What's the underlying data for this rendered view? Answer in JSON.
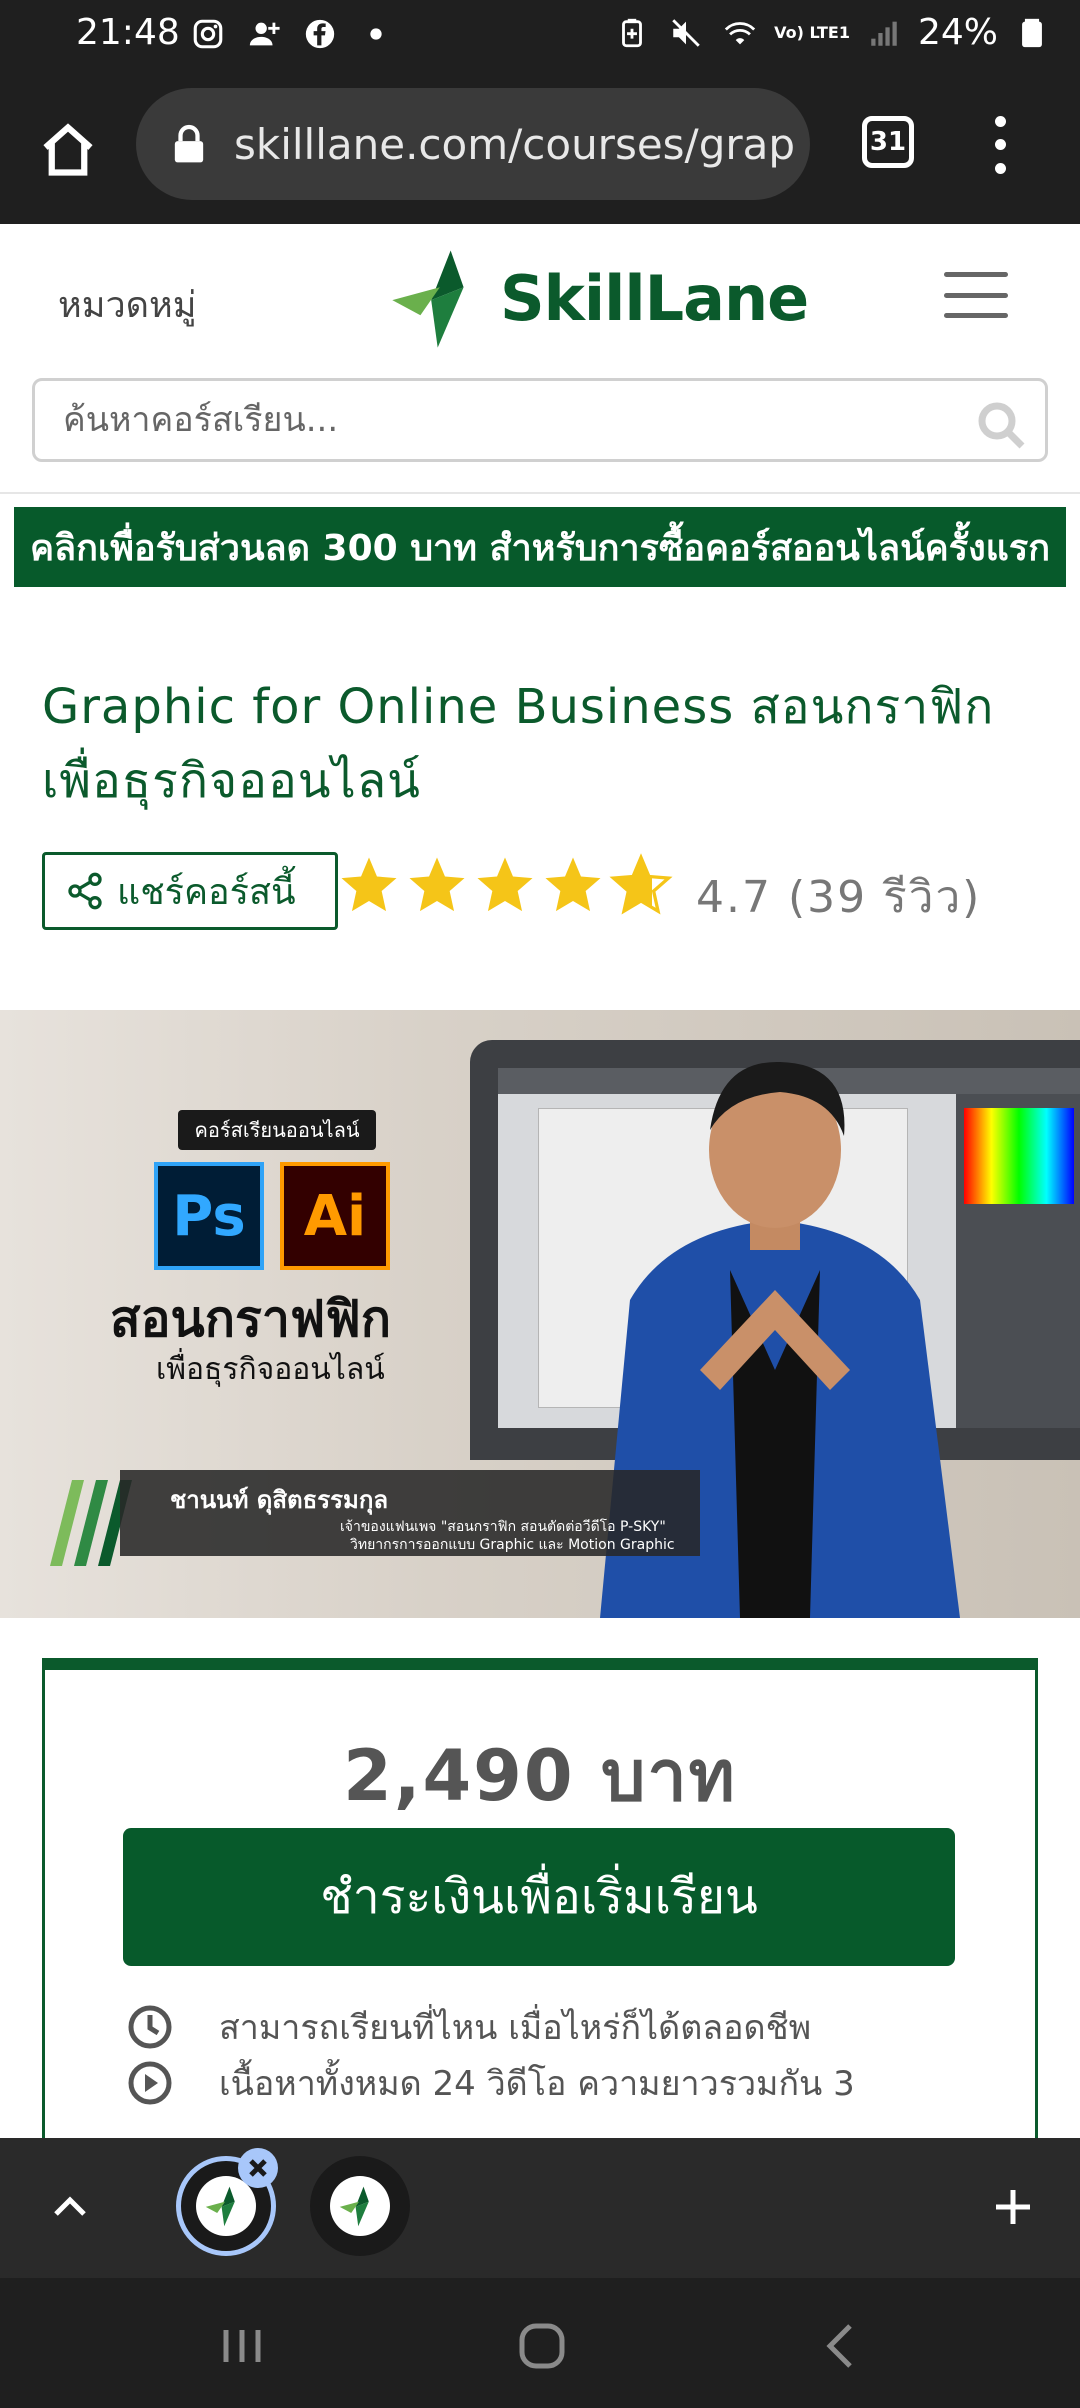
{
  "status_bar": {
    "time": "21:48",
    "battery": "24%",
    "signal_label": "Vo) LTE1"
  },
  "browser": {
    "url": "skilllane.com/courses/grap",
    "tab_count": "31"
  },
  "site": {
    "categories_label": "หมวดหมู่",
    "logo_text": "SkillLane",
    "search_placeholder": "ค้นหาคอร์สเรียน...",
    "promo_text": "คลิกเพื่อรับส่วนลด 300 บาท สำหรับการซื้อคอร์สออนไลน์ครั้งแรก"
  },
  "course": {
    "title": "Graphic for Online Business สอนกราฟิก เพื่อธุรกิจออนไลน์",
    "share_label": "แชร์คอร์สนี้",
    "rating_value": 4.7,
    "rating_text": "4.7 (39 รีวิว)"
  },
  "hero": {
    "badge": "คอร์สเรียนออนไลน์",
    "ps_label": "Ps",
    "ai_label": "Ai",
    "title": "สอนกราฟฟิก",
    "subtitle": "เพื่อธุรกิจออนไลน์",
    "instructor_name": "ชานนท์ ดุสิตธรรมกุล",
    "instructor_desc_1": "เจ้าของแฟนเพจ \"สอนกราฟิก สอนตัดต่อวีดีโอ P-SKY\"",
    "instructor_desc_2": "วิทยากรการออกแบบ Graphic และ Motion Graphic"
  },
  "purchase": {
    "price": "2,490 บาท",
    "pay_button": "ชำระเงินเพื่อเริ่มเรียน",
    "features": [
      "สามารถเรียนที่ไหน เมื่อไหร่ก็ได้ตลอดชีพ",
      "เนื้อหาทั้งหมด 24 วิดีโอ ความยาวรวมกัน 3"
    ]
  },
  "colors": {
    "brand_green": "#075a2b",
    "star_yellow": "#f5c518",
    "dark_chrome": "#1f1f1f"
  }
}
